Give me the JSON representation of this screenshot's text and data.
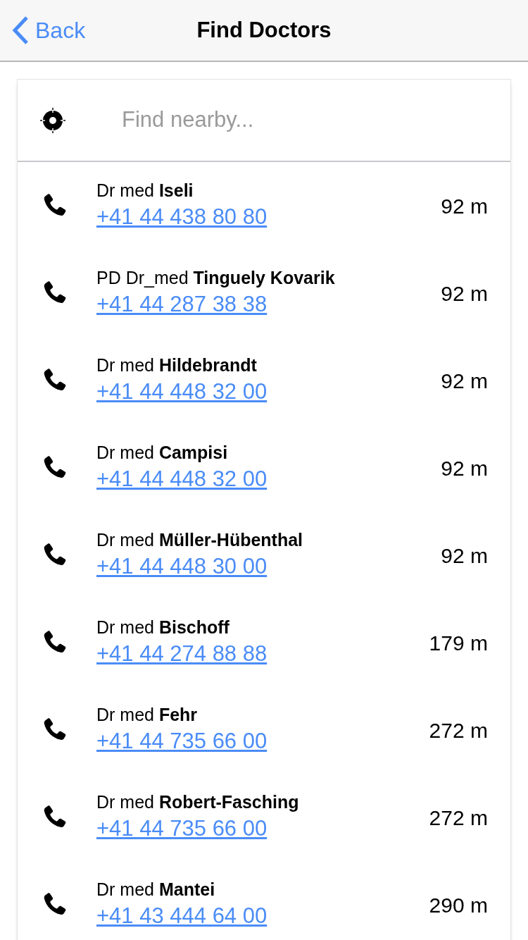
{
  "nav": {
    "back": "Back",
    "title": "Find Doctors"
  },
  "search": {
    "placeholder": "Find nearby..."
  },
  "doctors": [
    {
      "name": "Dr med **Iseli**",
      "phone": "+41 44 438 80 80",
      "distance": "92 m"
    },
    {
      "name": "PD Dr_med **Tinguely Kovarik**",
      "phone": "+41 44 287 38 38",
      "distance": "92 m"
    },
    {
      "name": "Dr med **Hildebrandt**",
      "phone": "+41 44 448 32 00",
      "distance": "92 m"
    },
    {
      "name": "Dr med **Campisi**",
      "phone": "+41 44 448 32 00",
      "distance": "92 m"
    },
    {
      "name": "Dr med **Müller-Hübenthal**",
      "phone": "+41 44 448 30 00",
      "distance": "92 m"
    },
    {
      "name": "Dr med **Bischoff**",
      "phone": "+41 44 274 88 88",
      "distance": "179 m"
    },
    {
      "name": "Dr med **Fehr**",
      "phone": "+41 44 735 66 00",
      "distance": "272 m"
    },
    {
      "name": "Dr med **Robert-Fasching**",
      "phone": "+41 44 735 66 00",
      "distance": "272 m"
    },
    {
      "name": "Dr med **Mantei**",
      "phone": "+41 43 444 64 00",
      "distance": "290 m"
    }
  ]
}
